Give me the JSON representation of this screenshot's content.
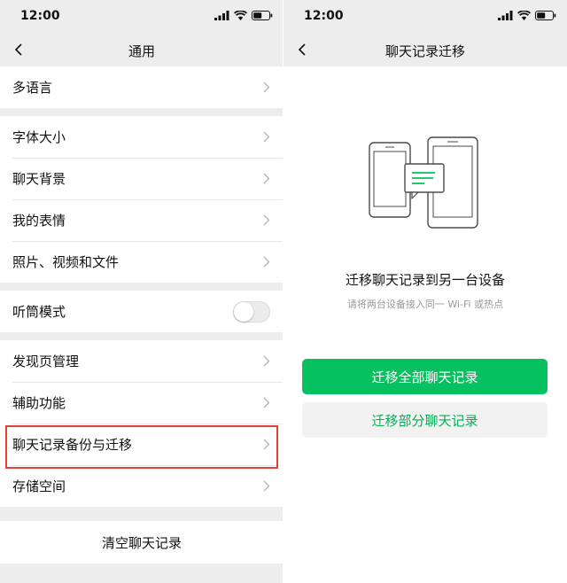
{
  "status_bar": {
    "time": "12:00"
  },
  "left": {
    "title": "通用",
    "items": [
      {
        "label": "多语言"
      },
      {
        "label": "字体大小"
      },
      {
        "label": "聊天背景"
      },
      {
        "label": "我的表情"
      },
      {
        "label": "照片、视频和文件"
      },
      {
        "label": "听筒模式",
        "toggle_on": false
      },
      {
        "label": "发现页管理"
      },
      {
        "label": "辅助功能"
      },
      {
        "label": "聊天记录备份与迁移"
      },
      {
        "label": "存储空间"
      }
    ],
    "clear_label": "清空聊天记录"
  },
  "right": {
    "title": "聊天记录迁移",
    "heading": "迁移聊天记录到另一台设备",
    "subtext": "请将两台设备接入同一 Wi-Fi 或热点",
    "primary_button": "迁移全部聊天记录",
    "secondary_button": "迁移部分聊天记录"
  },
  "colors": {
    "accent": "#07c160",
    "accent_text": "#06ae56",
    "highlight_border": "#e3403a",
    "page_bg": "#ededed"
  }
}
